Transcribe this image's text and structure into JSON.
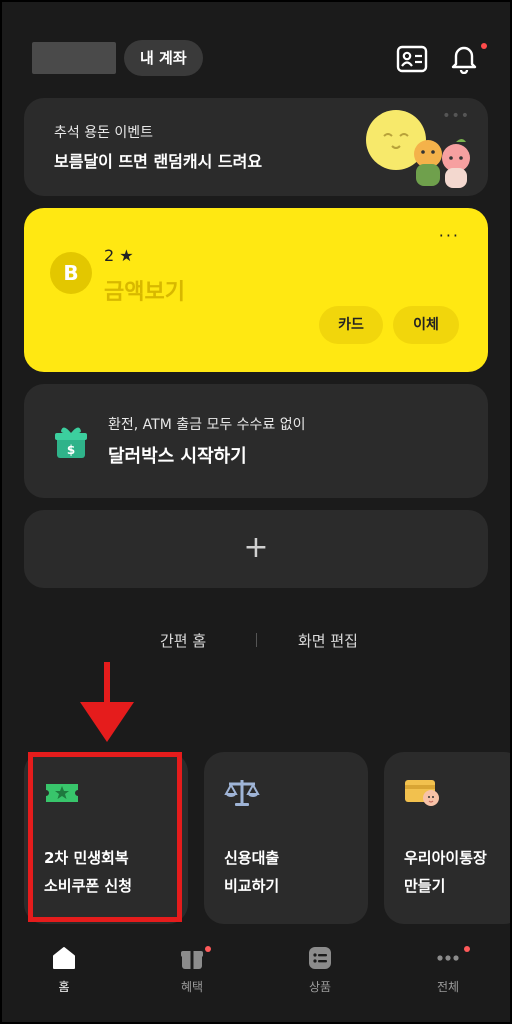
{
  "header": {
    "account_button": "내 계좌"
  },
  "event_banner": {
    "subtitle": "추석 용돈 이벤트",
    "title": "보름달이 뜨면 랜덤캐시 드려요",
    "more": "•••"
  },
  "bank_card": {
    "logo": "B",
    "account_number": "2 ★",
    "amount_label": "금액보기",
    "more": "···",
    "card_button": "카드",
    "transfer_button": "이체"
  },
  "dollar_box": {
    "subtitle": "환전, ATM 출금 모두 수수료 없이",
    "title": "달러박스 시작하기"
  },
  "add_card": {
    "plus": "+"
  },
  "links": {
    "simple_home": "간편 홈",
    "edit_screen": "화면 편집"
  },
  "tiles": [
    {
      "line1": "2차 민생회복",
      "line2": "소비쿠폰 신청"
    },
    {
      "line1": "신용대출",
      "line2": "비교하기"
    },
    {
      "line1": "우리아이통장",
      "line2": "만들기"
    }
  ],
  "tabbar": {
    "tabs": [
      {
        "label": "홈"
      },
      {
        "label": "혜택"
      },
      {
        "label": "상품"
      },
      {
        "label": "전체"
      }
    ]
  },
  "colors": {
    "background": "#1b1b1b",
    "card": "#2b2b2b",
    "brand_yellow": "#ffe812",
    "highlight_red": "#e51c1c",
    "notification_red": "#ff5a5a"
  }
}
